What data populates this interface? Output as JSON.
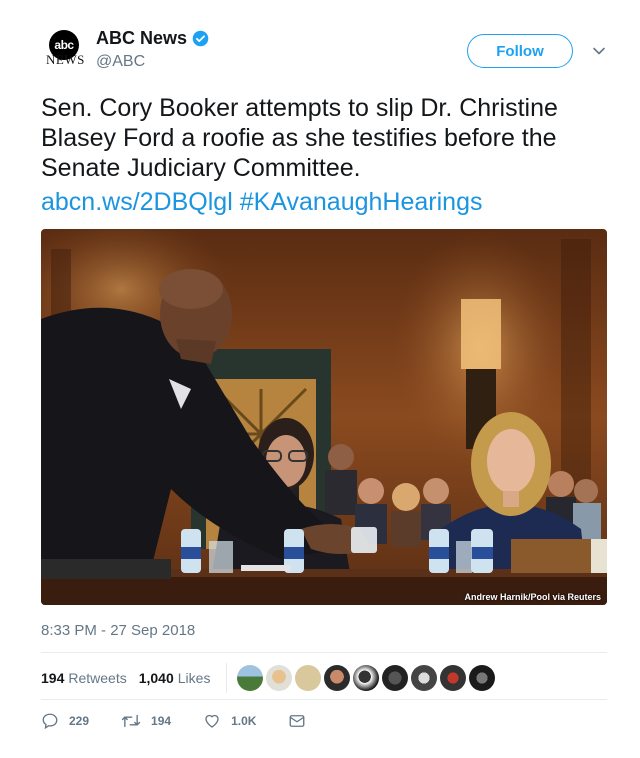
{
  "header": {
    "avatar_letters": "abc",
    "brand_text": "NEWS",
    "display_name": "ABC News",
    "handle": "@ABC",
    "follow_label": "Follow"
  },
  "tweet": {
    "text": "Sen. Cory Booker attempts to slip Dr. Christine Blasey Ford a roofie as she testifies before the Senate Judiciary Committee.",
    "link_text": "abcn.ws/2DBQlgl #KAvanaughHearings",
    "photo_credit": "Andrew Harnik/Pool via Reuters",
    "timestamp": "8:33 PM - 27 Sep 2018"
  },
  "stats": {
    "retweets_count": "194",
    "retweets_label": "Retweets",
    "likes_count": "1,040",
    "likes_label": "Likes"
  },
  "actions": {
    "reply_count": "229",
    "retweet_count": "194",
    "like_count": "1.0K"
  },
  "colors": {
    "accent": "#1da1f2",
    "link": "#1b95e0",
    "secondary_text": "#657786"
  }
}
